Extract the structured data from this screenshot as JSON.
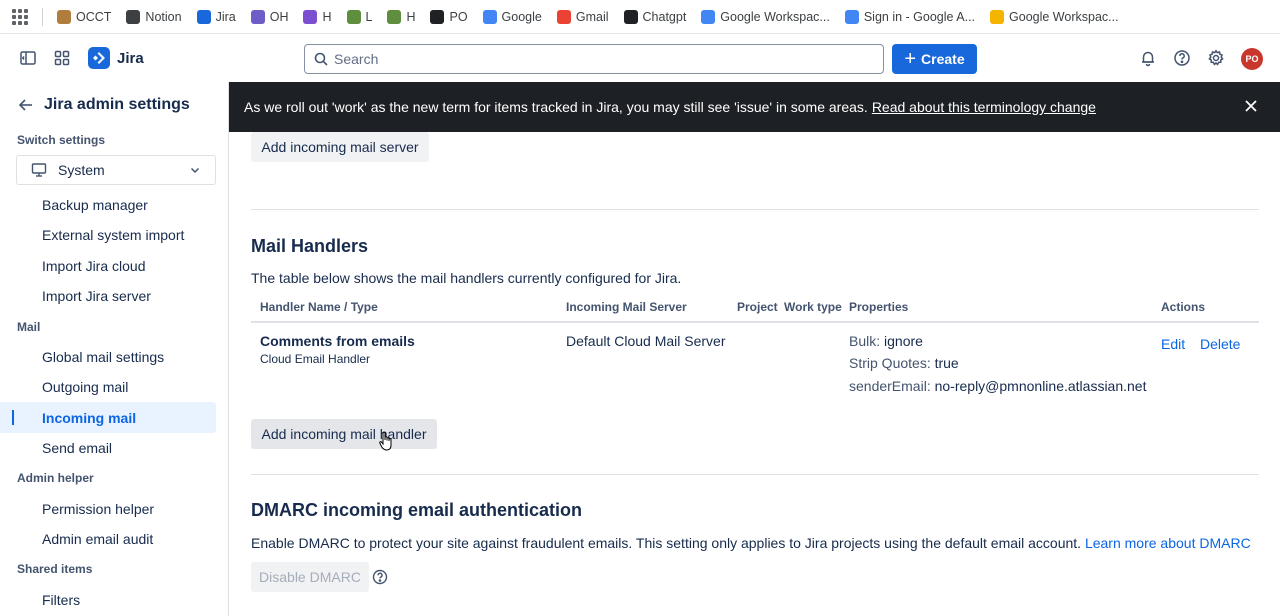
{
  "bookmarks": [
    {
      "label": "OCCT",
      "icon": "box-icon",
      "color": "#b07d3c"
    },
    {
      "label": "Notion",
      "icon": "home-icon",
      "color": "#3c4043"
    },
    {
      "label": "Jira",
      "icon": "jira-icon",
      "color": "#1868db"
    },
    {
      "label": "OH",
      "icon": "loop-icon",
      "color": "#6e5dc6"
    },
    {
      "label": "H",
      "icon": "s-icon",
      "color": "#7b4fd0"
    },
    {
      "label": "L",
      "icon": "shopify-icon",
      "color": "#5e8e3e"
    },
    {
      "label": "H",
      "icon": "shopify-icon",
      "color": "#5e8e3e"
    },
    {
      "label": "PO",
      "icon": "record-icon",
      "color": "#202124"
    },
    {
      "label": "Google",
      "icon": "google-icon",
      "color": "#4285f4"
    },
    {
      "label": "Gmail",
      "icon": "gmail-icon",
      "color": "#ea4335"
    },
    {
      "label": "Chatgpt",
      "icon": "openai-icon",
      "color": "#202124"
    },
    {
      "label": "Google Workspac...",
      "icon": "google-icon",
      "color": "#4285f4"
    },
    {
      "label": "Sign in - Google A...",
      "icon": "google-icon",
      "color": "#4285f4"
    },
    {
      "label": "Google Workspac...",
      "icon": "slides-icon",
      "color": "#f4b400"
    }
  ],
  "topnav": {
    "app_name": "Jira",
    "search_placeholder": "Search",
    "create_label": "Create",
    "avatar_initials": "PO"
  },
  "sidebar": {
    "title": "Jira admin settings",
    "switch_label": "Switch settings",
    "switch_value": "System",
    "items_top": [
      "Backup manager",
      "External system import",
      "Import Jira cloud",
      "Import Jira server"
    ],
    "section_mail": "Mail",
    "items_mail": [
      "Global mail settings",
      "Outgoing mail",
      "Incoming mail",
      "Send email"
    ],
    "section_admin_helper": "Admin helper",
    "items_admin_helper": [
      "Permission helper",
      "Admin email audit"
    ],
    "section_shared": "Shared items",
    "items_shared": [
      "Filters"
    ]
  },
  "banner": {
    "text": "As we roll out 'work' as the new term for items tracked in Jira, you may still see 'issue' in some areas.",
    "link": "Read about this terminology change"
  },
  "main": {
    "add_server_label": "Add incoming mail server",
    "handlers_title": "Mail Handlers",
    "handlers_desc": "The table below shows the mail handlers currently configured for Jira.",
    "columns": [
      "Handler Name / Type",
      "Incoming Mail Server",
      "Project",
      "Work type",
      "Properties",
      "Actions"
    ],
    "row": {
      "name": "Comments from emails",
      "type": "Cloud Email Handler",
      "server": "Default Cloud Mail Server",
      "properties": [
        {
          "key": "Bulk:",
          "value": "ignore"
        },
        {
          "key": "Strip Quotes:",
          "value": "true"
        },
        {
          "key": "senderEmail:",
          "value": "no-reply@pmnonline.atlassian.net"
        }
      ],
      "edit": "Edit",
      "delete": "Delete"
    },
    "add_handler_label": "Add incoming mail handler",
    "dmarc_title": "DMARC incoming email authentication",
    "dmarc_desc": "Enable DMARC to protect your site against fraudulent emails. This setting only applies to Jira projects using the default email account.",
    "dmarc_link": "Learn more about DMARC",
    "dmarc_button": "Disable DMARC"
  }
}
